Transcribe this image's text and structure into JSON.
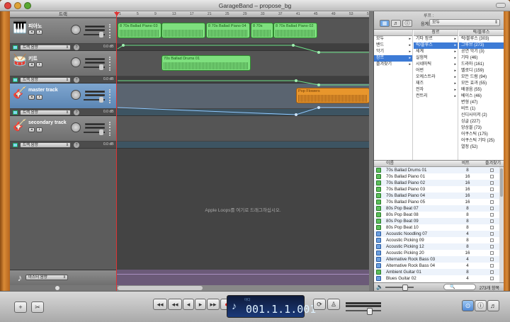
{
  "window": {
    "title": "GarageBand – propose_bg"
  },
  "headers": {
    "column_title": "트랙",
    "tracks": [
      {
        "name": "피아노",
        "icon": "piano-icon",
        "automation": "트랙 음량",
        "selected": false
      },
      {
        "name": "키트",
        "icon": "drums-icon",
        "automation": "트랙 음량",
        "selected": false
      },
      {
        "name": "master track",
        "icon": "guitar-icon",
        "automation": "트랙 음량",
        "selected": true
      },
      {
        "name": "secondary track",
        "icon": "guitar-icon",
        "automation": "트랙 음량",
        "selected": false
      }
    ],
    "master": {
      "automation": "마스터 음량"
    }
  },
  "timeline": {
    "ruler": [
      "1",
      "5",
      "9",
      "13",
      "17",
      "21",
      "25",
      "29",
      "33",
      "37",
      "41",
      "45",
      "49",
      "53",
      "57"
    ],
    "db_labels": [
      "0.0 dB",
      "0.0 dB",
      "0.0 dB",
      "0.0 dB"
    ],
    "regions_track1": [
      "8 70s Ballad Piano 03",
      "",
      "8 70s Ballad Piano 04",
      "8 70s",
      "8 70s Ballad Piano 02"
    ],
    "regions_track2": [
      "70s Ballad Drums 01"
    ],
    "regions_track3": [
      "Pop Flowers"
    ],
    "drop_hint": "Apple Loops를 여기로 드래그하십시오."
  },
  "browser": {
    "preset_label": "루프 :",
    "scale_label": "음계:",
    "scale_value": "모두",
    "col1": {
      "header": "",
      "items": [
        "모두",
        "밴드",
        "악기",
        "장르",
        "즐겨찾기"
      ],
      "selected": 3
    },
    "col2": {
      "header": "장르",
      "items": [
        "기타 장르",
        "락/블루스",
        "세계",
        "실험적",
        "시네마틱",
        "어번",
        "오케스트라",
        "재즈",
        "전자",
        "컨트리"
      ],
      "selected": 1
    },
    "col3": {
      "header": "락/블루스",
      "items": [
        "락/블루스 (303)",
        "그루브 (273)",
        "공연 악기 (3)",
        "기타 (46)",
        "드라마 (161)",
        "멜로디 (159)",
        "모든 드럼 (94)",
        "모든 효과 (55)",
        "배경음 (55)",
        "베이스 (46)",
        "변형 (47)",
        "비트 (1)",
        "신디사이저 (2)",
        "싱글 (227)",
        "앙상블 (73)",
        "어쿠스틱 (175)",
        "어쿠스틱 기타 (25)",
        "열정 (52)"
      ],
      "selected": 1
    },
    "results_header": {
      "name": "이름",
      "beat": "비트",
      "fav": "즐겨찾기"
    },
    "results": [
      {
        "name": "70s Ballad Drums 01",
        "beat": "8",
        "type": "green"
      },
      {
        "name": "70s Ballad Piano 01",
        "beat": "16",
        "type": "green"
      },
      {
        "name": "70s Ballad Piano 02",
        "beat": "16",
        "type": "green"
      },
      {
        "name": "70s Ballad Piano 03",
        "beat": "16",
        "type": "green"
      },
      {
        "name": "70s Ballad Piano 04",
        "beat": "16",
        "type": "green"
      },
      {
        "name": "70s Ballad Piano 05",
        "beat": "16",
        "type": "green"
      },
      {
        "name": "80s Pop Beat 07",
        "beat": "8",
        "type": "green"
      },
      {
        "name": "80s Pop Beat 08",
        "beat": "8",
        "type": "green"
      },
      {
        "name": "80s Pop Beat 09",
        "beat": "8",
        "type": "green"
      },
      {
        "name": "80s Pop Beat 10",
        "beat": "8",
        "type": "green"
      },
      {
        "name": "Acoustic Noodling 07",
        "beat": "4",
        "type": "blue"
      },
      {
        "name": "Acoustic Picking 09",
        "beat": "8",
        "type": "blue"
      },
      {
        "name": "Acoustic Picking 12",
        "beat": "8",
        "type": "blue"
      },
      {
        "name": "Acoustic Picking 20",
        "beat": "16",
        "type": "blue"
      },
      {
        "name": "Alternative Rock Bass 03",
        "beat": "4",
        "type": "blue"
      },
      {
        "name": "Alternative Rock Bass 04",
        "beat": "4",
        "type": "blue"
      },
      {
        "name": "Ambient Guitar 01",
        "beat": "8",
        "type": "green"
      },
      {
        "name": "Blues Guitar 02",
        "beat": "4",
        "type": "blue"
      }
    ],
    "count": "273개 항목"
  },
  "toolbar": {
    "add_label": "+",
    "loop_label": "⟳",
    "lcd_label": "마디",
    "lcd_time": "001.1.1.001"
  }
}
